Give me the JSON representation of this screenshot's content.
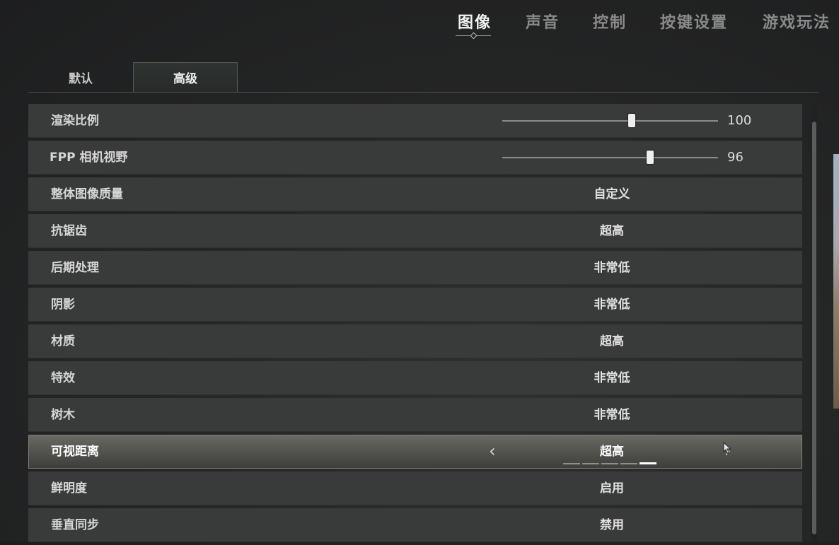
{
  "nav": {
    "tabs": [
      {
        "label": "图像",
        "active": true
      },
      {
        "label": "声音",
        "active": false
      },
      {
        "label": "控制",
        "active": false
      },
      {
        "label": "按键设置",
        "active": false
      },
      {
        "label": "游戏玩法",
        "active": false
      }
    ]
  },
  "subtabs": {
    "default_label": "默认",
    "advanced_label": "高级",
    "active": "高级"
  },
  "settings": {
    "render_scale": {
      "label": "渲染比例",
      "value": "100",
      "slider_fraction": 0.6
    },
    "fpp_fov": {
      "label": "FPP 相机视野",
      "value": "96",
      "slider_fraction": 0.69
    },
    "overall_quality": {
      "label": "整体图像质量",
      "value": "自定义"
    },
    "anti_aliasing": {
      "label": "抗锯齿",
      "value": "超高"
    },
    "post_processing": {
      "label": "后期处理",
      "value": "非常低"
    },
    "shadows": {
      "label": "阴影",
      "value": "非常低"
    },
    "textures": {
      "label": "材质",
      "value": "超高"
    },
    "effects": {
      "label": "特效",
      "value": "非常低"
    },
    "foliage": {
      "label": "树木",
      "value": "非常低"
    },
    "view_distance": {
      "label": "可视距离",
      "value": "超高",
      "levels": 5,
      "current_level": 5
    },
    "sharpen": {
      "label": "鲜明度",
      "value": "启用"
    },
    "vsync": {
      "label": "垂直同步",
      "value": "禁用"
    }
  },
  "icons": {
    "left": "chevron-left-icon",
    "right": "chevron-right-icon",
    "cursor": "mouse-cursor-icon"
  }
}
